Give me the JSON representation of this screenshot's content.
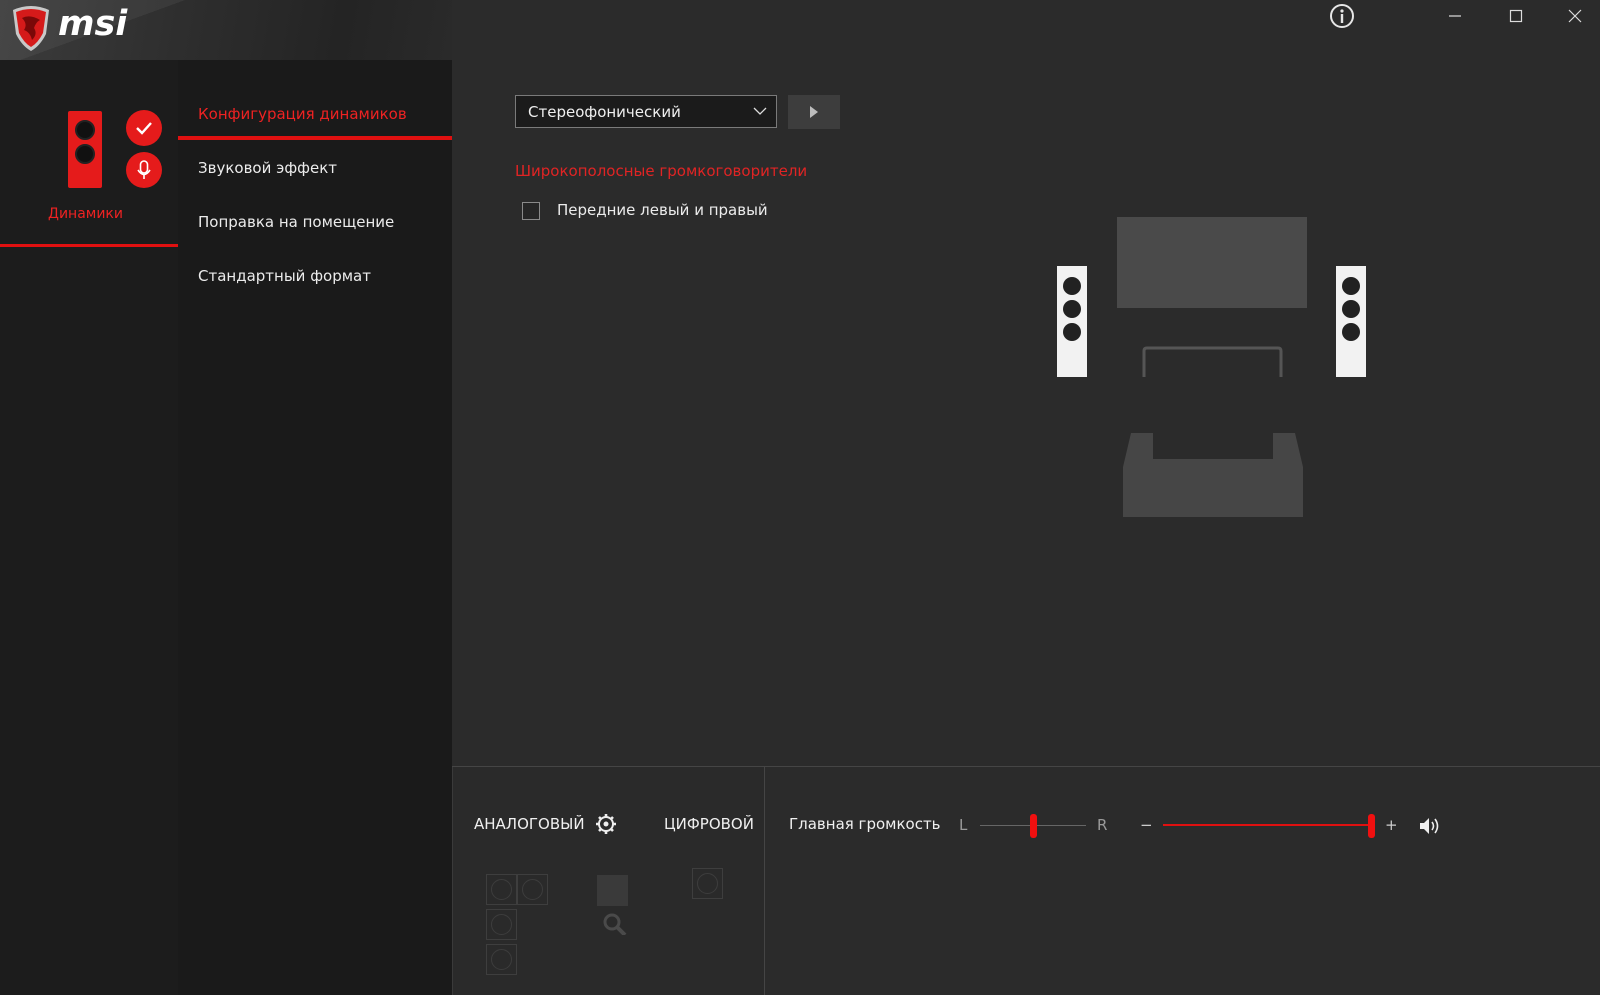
{
  "app": {
    "logo_text": "msi",
    "brand_color": "#e01010"
  },
  "window_controls": {
    "info_icon": "info-icon",
    "minimize_icon": "minimize-icon",
    "maximize_icon": "maximize-icon",
    "close_icon": "close-icon"
  },
  "device": {
    "label": "Динамики",
    "icons": [
      "speaker-icon",
      "check-badge-icon",
      "microphone-badge-icon"
    ]
  },
  "nav": {
    "items": [
      {
        "label": "Конфигурация динамиков",
        "active": true
      },
      {
        "label": "Звуковой эффект",
        "active": false
      },
      {
        "label": "Поправка на помещение",
        "active": false
      },
      {
        "label": "Стандартный формат",
        "active": false
      }
    ]
  },
  "config": {
    "dropdown_value": "Стереофонический",
    "play_icon": "play-icon",
    "section_title": "Широкополосные громкоговорители",
    "checkbox_label": "Передние левый и правый",
    "checkbox_checked": false
  },
  "bottom": {
    "analog_label": "АНАЛОГОВЫЙ",
    "digital_label": "ЦИФРОВОЙ",
    "gear_icon": "gear-icon",
    "master_volume_label": "Главная громкость",
    "balance_left": "L",
    "balance_right": "R",
    "minus": "−",
    "plus": "+",
    "balance_level": 0.5,
    "volume_level": 1.0,
    "volume_icon": "volume-icon"
  }
}
